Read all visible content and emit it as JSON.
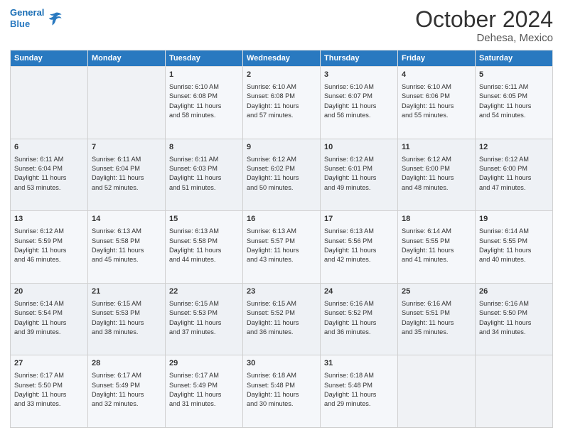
{
  "logo": {
    "line1": "General",
    "line2": "Blue"
  },
  "title": "October 2024",
  "subtitle": "Dehesa, Mexico",
  "days_of_week": [
    "Sunday",
    "Monday",
    "Tuesday",
    "Wednesday",
    "Thursday",
    "Friday",
    "Saturday"
  ],
  "weeks": [
    [
      {
        "day": "",
        "content": ""
      },
      {
        "day": "",
        "content": ""
      },
      {
        "day": "1",
        "content": "Sunrise: 6:10 AM\nSunset: 6:08 PM\nDaylight: 11 hours\nand 58 minutes."
      },
      {
        "day": "2",
        "content": "Sunrise: 6:10 AM\nSunset: 6:08 PM\nDaylight: 11 hours\nand 57 minutes."
      },
      {
        "day": "3",
        "content": "Sunrise: 6:10 AM\nSunset: 6:07 PM\nDaylight: 11 hours\nand 56 minutes."
      },
      {
        "day": "4",
        "content": "Sunrise: 6:10 AM\nSunset: 6:06 PM\nDaylight: 11 hours\nand 55 minutes."
      },
      {
        "day": "5",
        "content": "Sunrise: 6:11 AM\nSunset: 6:05 PM\nDaylight: 11 hours\nand 54 minutes."
      }
    ],
    [
      {
        "day": "6",
        "content": "Sunrise: 6:11 AM\nSunset: 6:04 PM\nDaylight: 11 hours\nand 53 minutes."
      },
      {
        "day": "7",
        "content": "Sunrise: 6:11 AM\nSunset: 6:04 PM\nDaylight: 11 hours\nand 52 minutes."
      },
      {
        "day": "8",
        "content": "Sunrise: 6:11 AM\nSunset: 6:03 PM\nDaylight: 11 hours\nand 51 minutes."
      },
      {
        "day": "9",
        "content": "Sunrise: 6:12 AM\nSunset: 6:02 PM\nDaylight: 11 hours\nand 50 minutes."
      },
      {
        "day": "10",
        "content": "Sunrise: 6:12 AM\nSunset: 6:01 PM\nDaylight: 11 hours\nand 49 minutes."
      },
      {
        "day": "11",
        "content": "Sunrise: 6:12 AM\nSunset: 6:00 PM\nDaylight: 11 hours\nand 48 minutes."
      },
      {
        "day": "12",
        "content": "Sunrise: 6:12 AM\nSunset: 6:00 PM\nDaylight: 11 hours\nand 47 minutes."
      }
    ],
    [
      {
        "day": "13",
        "content": "Sunrise: 6:12 AM\nSunset: 5:59 PM\nDaylight: 11 hours\nand 46 minutes."
      },
      {
        "day": "14",
        "content": "Sunrise: 6:13 AM\nSunset: 5:58 PM\nDaylight: 11 hours\nand 45 minutes."
      },
      {
        "day": "15",
        "content": "Sunrise: 6:13 AM\nSunset: 5:58 PM\nDaylight: 11 hours\nand 44 minutes."
      },
      {
        "day": "16",
        "content": "Sunrise: 6:13 AM\nSunset: 5:57 PM\nDaylight: 11 hours\nand 43 minutes."
      },
      {
        "day": "17",
        "content": "Sunrise: 6:13 AM\nSunset: 5:56 PM\nDaylight: 11 hours\nand 42 minutes."
      },
      {
        "day": "18",
        "content": "Sunrise: 6:14 AM\nSunset: 5:55 PM\nDaylight: 11 hours\nand 41 minutes."
      },
      {
        "day": "19",
        "content": "Sunrise: 6:14 AM\nSunset: 5:55 PM\nDaylight: 11 hours\nand 40 minutes."
      }
    ],
    [
      {
        "day": "20",
        "content": "Sunrise: 6:14 AM\nSunset: 5:54 PM\nDaylight: 11 hours\nand 39 minutes."
      },
      {
        "day": "21",
        "content": "Sunrise: 6:15 AM\nSunset: 5:53 PM\nDaylight: 11 hours\nand 38 minutes."
      },
      {
        "day": "22",
        "content": "Sunrise: 6:15 AM\nSunset: 5:53 PM\nDaylight: 11 hours\nand 37 minutes."
      },
      {
        "day": "23",
        "content": "Sunrise: 6:15 AM\nSunset: 5:52 PM\nDaylight: 11 hours\nand 36 minutes."
      },
      {
        "day": "24",
        "content": "Sunrise: 6:16 AM\nSunset: 5:52 PM\nDaylight: 11 hours\nand 36 minutes."
      },
      {
        "day": "25",
        "content": "Sunrise: 6:16 AM\nSunset: 5:51 PM\nDaylight: 11 hours\nand 35 minutes."
      },
      {
        "day": "26",
        "content": "Sunrise: 6:16 AM\nSunset: 5:50 PM\nDaylight: 11 hours\nand 34 minutes."
      }
    ],
    [
      {
        "day": "27",
        "content": "Sunrise: 6:17 AM\nSunset: 5:50 PM\nDaylight: 11 hours\nand 33 minutes."
      },
      {
        "day": "28",
        "content": "Sunrise: 6:17 AM\nSunset: 5:49 PM\nDaylight: 11 hours\nand 32 minutes."
      },
      {
        "day": "29",
        "content": "Sunrise: 6:17 AM\nSunset: 5:49 PM\nDaylight: 11 hours\nand 31 minutes."
      },
      {
        "day": "30",
        "content": "Sunrise: 6:18 AM\nSunset: 5:48 PM\nDaylight: 11 hours\nand 30 minutes."
      },
      {
        "day": "31",
        "content": "Sunrise: 6:18 AM\nSunset: 5:48 PM\nDaylight: 11 hours\nand 29 minutes."
      },
      {
        "day": "",
        "content": ""
      },
      {
        "day": "",
        "content": ""
      }
    ]
  ]
}
